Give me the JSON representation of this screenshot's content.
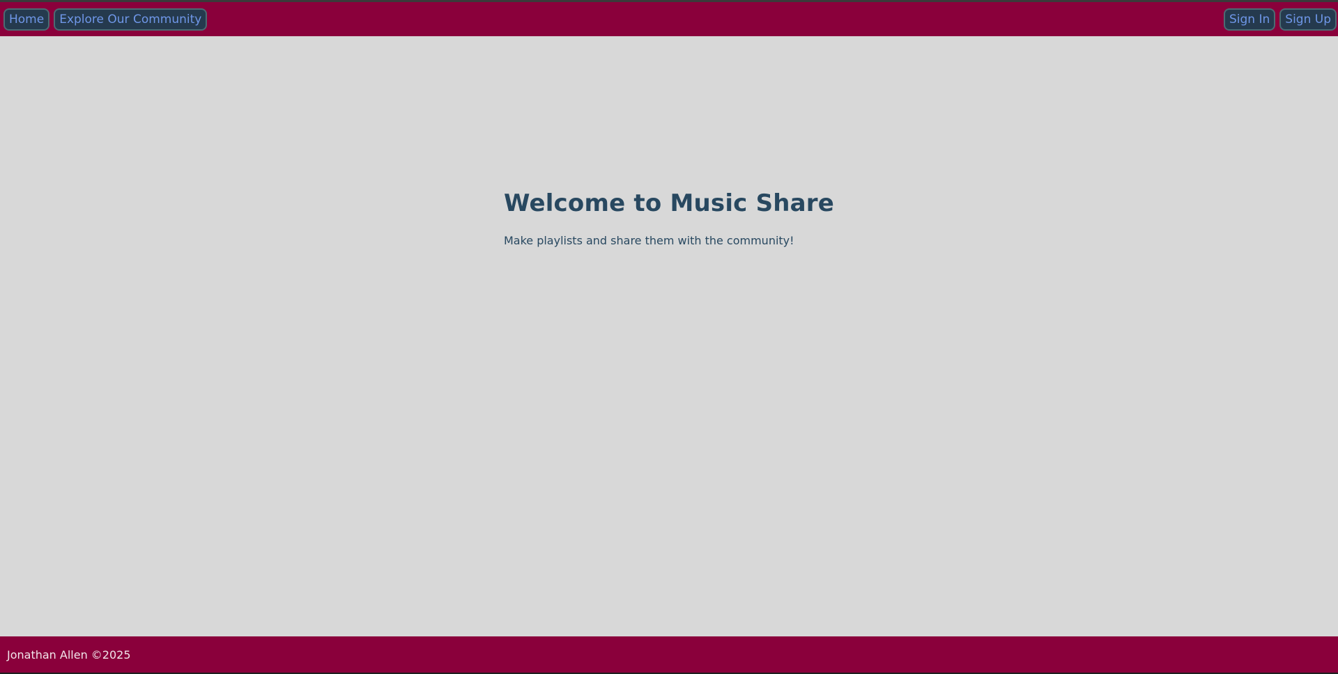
{
  "nav": {
    "left": [
      {
        "label": "Home"
      },
      {
        "label": "Explore Our Community"
      }
    ],
    "right": [
      {
        "label": "Sign In"
      },
      {
        "label": "Sign Up"
      }
    ]
  },
  "hero": {
    "title": "Welcome to Music Share",
    "subtitle": "Make playlists and share them with the community!"
  },
  "footer": {
    "text": "Jonathan Allen ©2025"
  },
  "colors": {
    "brand": "#8a003b",
    "background": "#d8d8d8",
    "button_bg": "#253a4e",
    "button_text": "#6f97e8",
    "heading_text": "#284860"
  }
}
